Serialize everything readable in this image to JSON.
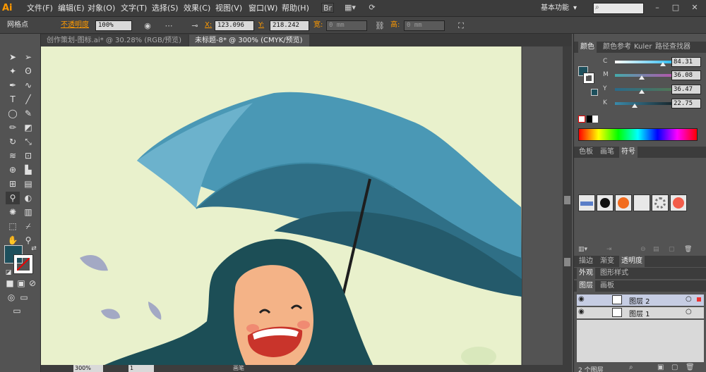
{
  "app": {
    "logo": "Ai"
  },
  "menu": [
    "文件(F)",
    "编辑(E)",
    "对象(O)",
    "文字(T)",
    "选择(S)",
    "效果(C)",
    "视图(V)",
    "窗口(W)",
    "帮助(H)"
  ],
  "workspace": "基本功能",
  "control": {
    "selection": "网格点",
    "opacity_label": "不透明度",
    "opacity_value": "100%",
    "x_label": "X:",
    "x_value": "123.096",
    "y_label": "Y:",
    "y_value": "218.242",
    "w_label": "宽:",
    "w_value": "0 mm",
    "h_label": "高:",
    "h_value": "0 mm"
  },
  "tabs": [
    {
      "label": "创作策划-图标.ai* @ 30.28% (RGB/预览)",
      "close": "×"
    },
    {
      "label": "未标题-8* @ 300% (CMYK/预览)",
      "close": "×"
    }
  ],
  "color_panel": {
    "tabs": [
      "颜色",
      "颜色参考",
      "Kuler",
      "路径查找器"
    ],
    "sliders": [
      {
        "label": "C",
        "value": "84.31"
      },
      {
        "label": "M",
        "value": "36.08"
      },
      {
        "label": "Y",
        "value": "36.47"
      },
      {
        "label": "K",
        "value": "22.75"
      }
    ],
    "fill_color": "#1d4f5c"
  },
  "symbol_panel": {
    "tabs": [
      "色板",
      "画笔",
      "符号"
    ]
  },
  "appearance_panel": {
    "tabs": [
      "描边",
      "渐变",
      "透明度"
    ]
  },
  "style_panel": {
    "tabs": [
      "外观",
      "图形样式"
    ]
  },
  "layers_panel": {
    "tabs": [
      "图层",
      "画板"
    ],
    "layers": [
      {
        "name": "图层 2"
      },
      {
        "name": "图层 1"
      }
    ],
    "footer": "2 个图层"
  },
  "status": {
    "zoom": "300%",
    "page": "1",
    "tool_name": "画笔"
  },
  "colors": {
    "artboard_bg": "#e9f1cc",
    "umbrella": "#4a98b5",
    "hair": "#1c4e56",
    "skin": "#f4b387",
    "accent": "#ff9a00"
  }
}
